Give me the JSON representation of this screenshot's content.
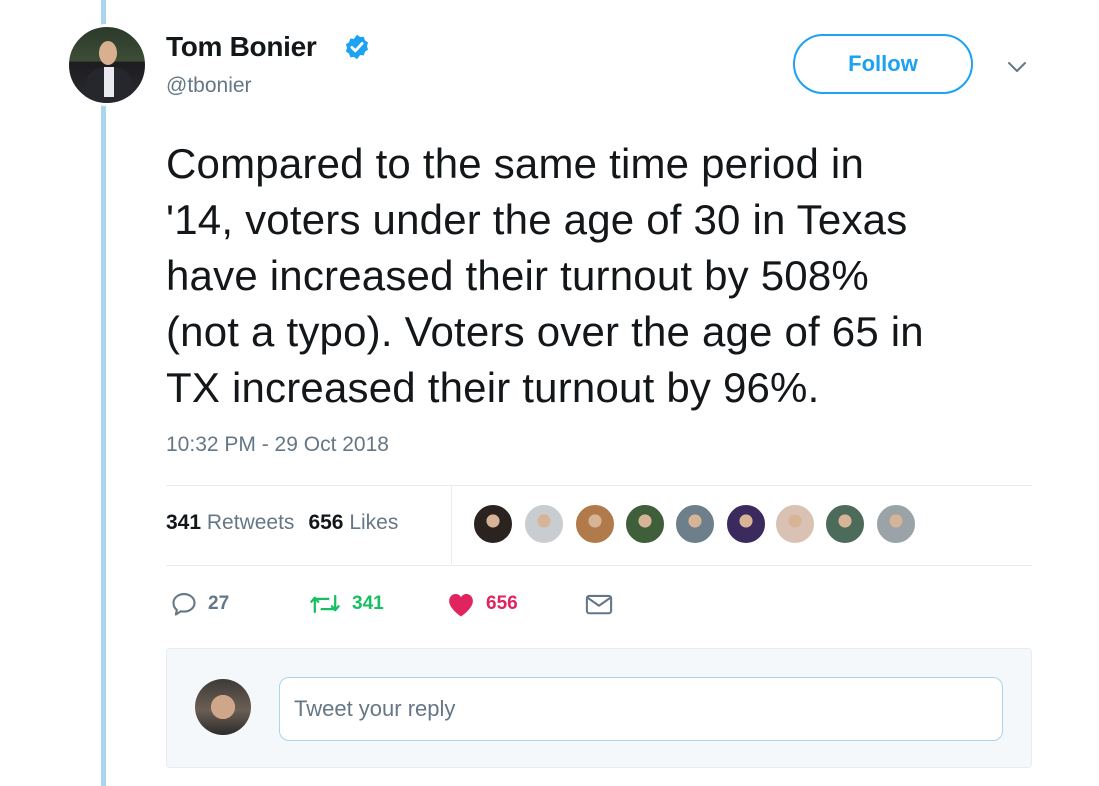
{
  "author": {
    "name": "Tom Bonier",
    "handle": "@tbonier",
    "verified": true,
    "avatar": "author-avatar"
  },
  "follow_label": "Follow",
  "tweet": {
    "lines": [
      "Compared to the same time period in",
      "'14, voters under the age of 30 in Texas",
      "have increased their turnout by 508%",
      "(not a typo). Voters over the age of 65 in",
      "TX increased their turnout by 96%."
    ],
    "timestamp": "10:32 PM - 29 Oct 2018"
  },
  "stats": {
    "retweets_count": "341",
    "retweets_label": "Retweets",
    "likes_count": "656",
    "likes_label": "Likes",
    "liker_avatars": [
      "#2a2320",
      "#c9ccd1",
      "#b07a4a",
      "#3f5e3a",
      "#6d7f8a",
      "#3a2a5e",
      "#d9c2b3",
      "#4d6b5a",
      "#9aa3a8"
    ]
  },
  "actions": {
    "reply_count": "27",
    "retweet_count": "341",
    "like_count": "656"
  },
  "reply": {
    "placeholder": "Tweet your reply"
  },
  "colors": {
    "accent": "#1da1f2",
    "retweet_green": "#17bf63",
    "like_red": "#e0245e",
    "secondary_text": "#657786",
    "thread_line": "#a9d5ef"
  }
}
